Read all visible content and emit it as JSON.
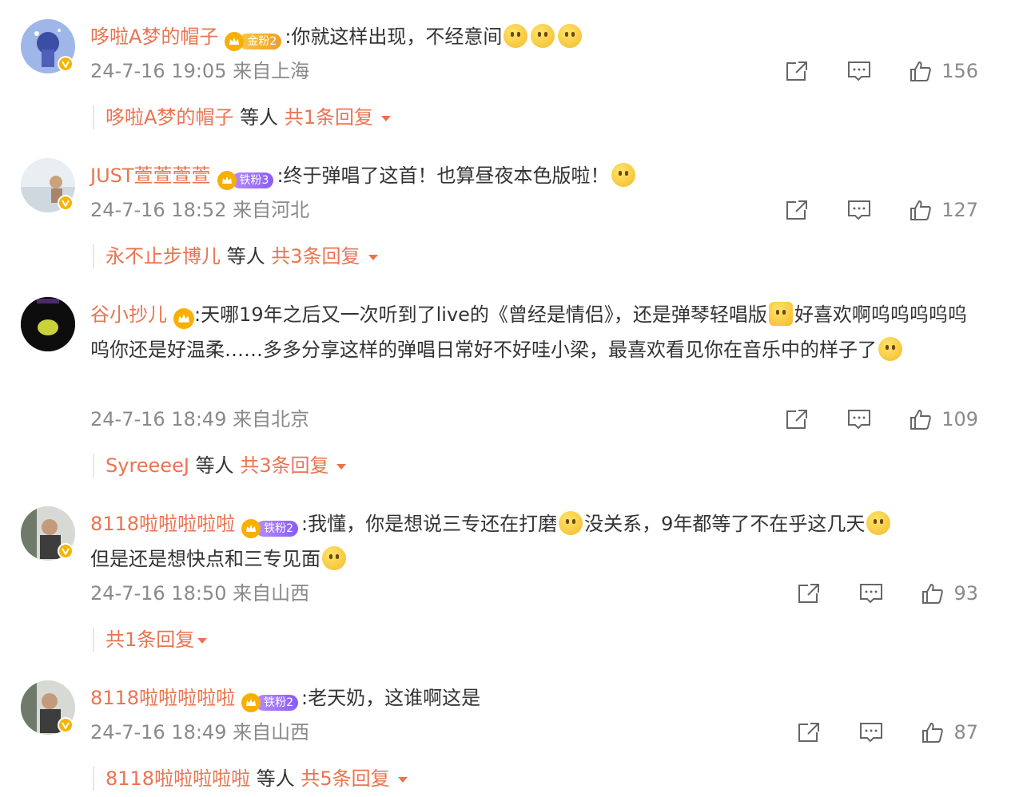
{
  "comments": [
    {
      "username": "哆啦A梦的帽子",
      "fan_badge": {
        "type": "gold",
        "label": "金粉2"
      },
      "text": ":你就这样出现，不经意间",
      "emojis_after": 3,
      "time": "24-7-16 19:05",
      "location": "来自上海",
      "likes": "156",
      "reply": {
        "user": "哆啦A梦的帽子",
        "mid": "等人",
        "count": "共1条回复"
      }
    },
    {
      "username": "JUST萱萱萱萱",
      "fan_badge": {
        "type": "purple",
        "label": "铁粉3"
      },
      "text": ":终于弹唱了这首！也算昼夜本色版啦！",
      "emojis_after": 1,
      "time": "24-7-16 18:52",
      "location": "来自河北",
      "likes": "127",
      "reply": {
        "user": "永不止步博儿",
        "mid": "等人",
        "count": "共3条回复"
      }
    },
    {
      "username": "谷小抄儿",
      "fan_badge": {
        "type": "crown",
        "label": ""
      },
      "text_a": ":天哪19年之后又一次听到了live的《曾经是情侣》，还是弹琴轻唱版",
      "text_b": "好喜欢啊呜呜呜呜呜呜你还是好温柔……多多分享这样的弹唱日常好不好哇小梁，最喜欢看见你在音乐中的样子了",
      "time": "24-7-16 18:49",
      "location": "来自北京",
      "likes": "109",
      "reply": {
        "user": "SyreeeeJ",
        "mid": "等人",
        "count": "共3条回复"
      }
    },
    {
      "username": "8118啦啦啦啦啦",
      "fan_badge": {
        "type": "purple",
        "label": "铁粉2"
      },
      "text_a": ":我懂，你是想说三专还在打磨",
      "text_b": "没关系，9年都等了不在乎这几天",
      "text_c": "但是还是想快点和三专见面",
      "time": "24-7-16 18:50",
      "location": "来自山西",
      "likes": "93",
      "reply": {
        "user": "",
        "mid": "",
        "count": "共1条回复"
      }
    },
    {
      "username": "8118啦啦啦啦啦",
      "fan_badge": {
        "type": "purple",
        "label": "铁粉2"
      },
      "text": ":老天奶，这谁啊这是",
      "emojis_after": 0,
      "time": "24-7-16 18:49",
      "location": "来自山西",
      "likes": "87",
      "reply": {
        "user": "8118啦啦啦啦啦",
        "mid": "等人",
        "count": "共5条回复"
      }
    }
  ]
}
